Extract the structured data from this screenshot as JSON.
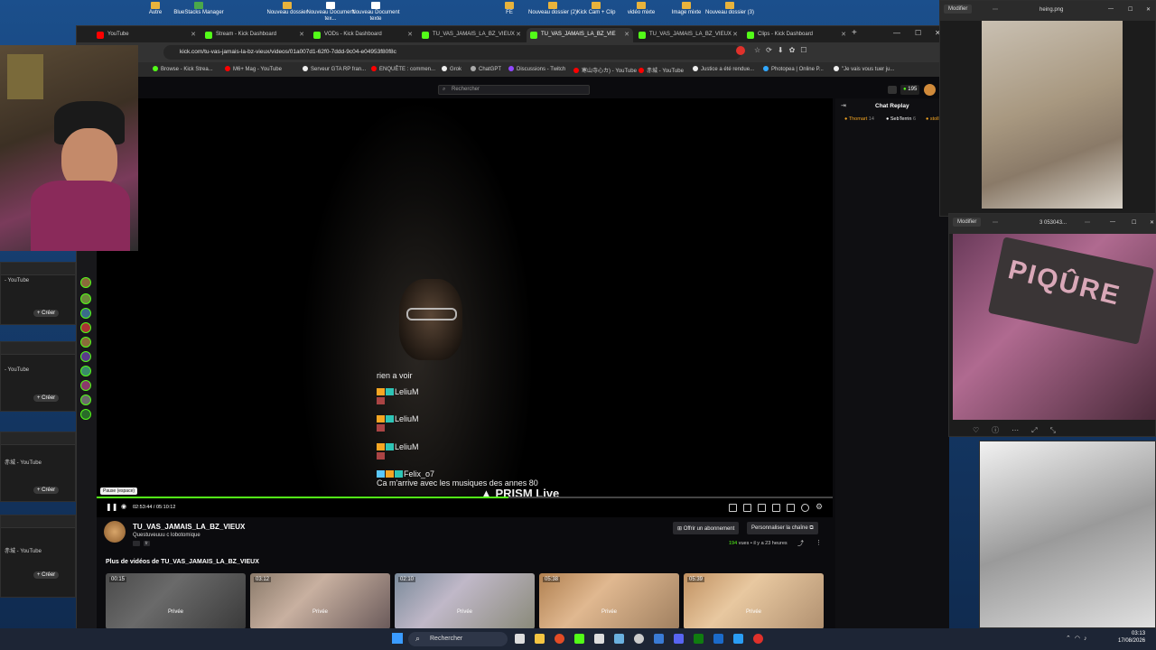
{
  "desktop_icons": [
    "Autre",
    "BlueStacks Manager",
    "Nouveau dossier",
    "Nouveau Document tex...",
    "Nouveau Document texte",
    "FE",
    "Nouveau dossier (2)",
    "Kick Cam + Clip",
    "vidéo mixte",
    "Image mixte",
    "Nouveau dossier (3)"
  ],
  "tabs": [
    "YouTube",
    "Stream - Kick Dashboard",
    "VODs - Kick Dashboard",
    "TU_VAS_JAMAIS_LA_BZ_VIEUX",
    "TU_VAS_JAMAIS_LA_BZ_VIE",
    "TU_VAS_JAMAIS_LA_BZ_VIEUX",
    "Clips - Kick Dashboard"
  ],
  "url": "kick.com/tu-vas-jamais-la-bz-vieux/videos/01a007d1-62f0-7ddd-9c04-e04953f80f8c",
  "bookmarks": [
    "Browse - Kick Strea...",
    "M6+ Mag - YouTube",
    "Serveur GTA RP fran...",
    "ENQUÊTE : commen...",
    "Grok",
    "ChatGPT",
    "Discussions - Twitch",
    "寒山寺心カ) - YouTube",
    "赤城 - YouTube",
    "Justice a été rendue...",
    "Photopea | Online P...",
    "\"Je vais vous tuer ju..."
  ],
  "kick": {
    "search_placeholder": "Rechercher",
    "viewer_count": "195",
    "chat_title": "Chat Replay",
    "chat_users": [
      "Thomart",
      "SebTerrin",
      "stoll"
    ],
    "chat_users_counts": [
      "14",
      "6",
      ""
    ],
    "overlay_messages": [
      {
        "user": "",
        "text": "rien a voir"
      },
      {
        "user": "LeliuM",
        "text": ""
      },
      {
        "user": "LeliuM",
        "text": ""
      },
      {
        "user": "LeliuM",
        "text": ""
      },
      {
        "user": "Felix_o7",
        "text": "Ca m'arrive avec les musiques des annes 80"
      }
    ],
    "prism": "PRISM Live",
    "tooltip": "Pause (espace)",
    "time": "02:53:44 / 05:10:12",
    "progress": 0.56,
    "channel_name": "TU_VAS_JAMAIS_LA_BZ_VIEUX",
    "video_title": "Questuveuuu c lobotomique",
    "channel_badge": "fr",
    "offer_button": "Offrir un abonnement",
    "customize_button": "Personnaliser la chaîne",
    "views": "194",
    "views_label": "vues",
    "age": "il y a 23 heures",
    "more_videos": "Plus de vidéos de TU_VAS_JAMAIS_LA_BZ_VIEUX",
    "thumbnails": [
      {
        "duration": "00:15",
        "label": "Privée"
      },
      {
        "duration": "03:12",
        "label": "Privée"
      },
      {
        "duration": "02:10",
        "label": "Privée"
      },
      {
        "duration": "05:38",
        "label": "Privée"
      },
      {
        "duration": "05:39",
        "label": "Privée"
      }
    ]
  },
  "yt_panels": [
    {
      "title": "- YouTube",
      "button": "Créer"
    },
    {
      "title": "- YouTube",
      "button": "Créer"
    },
    {
      "title": "赤城 - YouTube",
      "button": "Créer"
    },
    {
      "title": "赤城 - YouTube",
      "button": "Créer"
    }
  ],
  "right_windows": {
    "top": {
      "edit": "Modifier",
      "file": "heing.png"
    },
    "middle": {
      "edit": "Modifier",
      "file": "3 053043..."
    },
    "sign_text": "PIQÛRE"
  },
  "taskbar": {
    "search": "Rechercher",
    "time": "03:13",
    "date": "17/08/2026"
  },
  "colors": {
    "kick_green": "#53fc18",
    "desktop_blue": "#1b4f8c"
  }
}
